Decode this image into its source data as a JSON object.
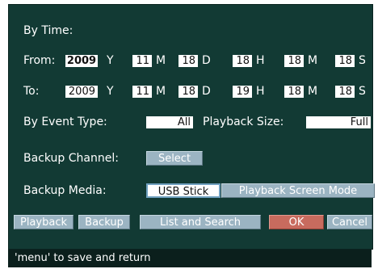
{
  "section_title": "By Time:",
  "from": {
    "label": "From:",
    "year": "2009",
    "y_unit": "Y",
    "month": "11",
    "m_unit": "M",
    "day": "18",
    "d_unit": "D",
    "hour": "18",
    "h_unit": "H",
    "minute": "18",
    "min_unit": "M",
    "second": "18",
    "s_unit": "S"
  },
  "to": {
    "label": "To:",
    "year": "2009",
    "y_unit": "Y",
    "month": "11",
    "m_unit": "M",
    "day": "18",
    "d_unit": "D",
    "hour": "19",
    "h_unit": "H",
    "minute": "18",
    "min_unit": "M",
    "second": "18",
    "s_unit": "S"
  },
  "event_type": {
    "label": "By Event Type:",
    "value": "All"
  },
  "playback_size": {
    "label": "Playback Size:",
    "value": "Full"
  },
  "backup_channel": {
    "label": "Backup Channel:",
    "button": "Select"
  },
  "backup_media": {
    "label": "Backup Media:",
    "value": "USB Stick",
    "mode_button": "Playback Screen Mode"
  },
  "actions": {
    "playback": "Playback",
    "backup": "Backup",
    "list_search": "List and Search",
    "ok": "OK",
    "cancel": "Cancel"
  },
  "status": "'menu' to save and return",
  "colors": {
    "panel_bg": "#123a34",
    "button_bg": "#9bb4c2",
    "ok_bg": "#c86b5e",
    "status_bg": "#0b1f1c"
  }
}
